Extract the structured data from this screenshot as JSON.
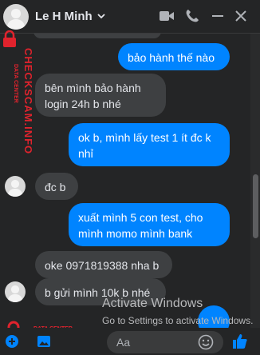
{
  "header": {
    "name": "Le H Minh",
    "icons": [
      "chevron-down-icon",
      "video-icon",
      "phone-icon",
      "minimize-icon",
      "close-icon"
    ]
  },
  "messages": [
    {
      "id": "m0",
      "from": "contact",
      "text": ""
    },
    {
      "id": "m1",
      "from": "me",
      "text": "bảo hành thế nào"
    },
    {
      "id": "m2",
      "from": "contact",
      "text": "bên mình bảo hành login 24h b nhé"
    },
    {
      "id": "m3",
      "from": "me",
      "text": "ok b, mình lấy test 1 ít đc k nhỉ"
    },
    {
      "id": "m4",
      "from": "contact",
      "text": "đc b"
    },
    {
      "id": "m5",
      "from": "me",
      "text": "xuất mình 5 con test, cho mình momo mình bank"
    },
    {
      "id": "m6",
      "from": "contact",
      "text": "oke 0971819388 nha b"
    },
    {
      "id": "m7",
      "from": "contact",
      "text": "b gửi mình 10k b nhé"
    }
  ],
  "watermark": {
    "small": "DATA CENTER",
    "big": "CHECKSCAM.INFO"
  },
  "activation": {
    "title": "Activate Windows",
    "subtitle": "Go to Settings to activate Windows."
  },
  "composer": {
    "placeholder": "Aa"
  },
  "colors": {
    "outgoing": "#0084ff",
    "incoming": "#3e4042",
    "background": "#242526",
    "watermark": "#e0232d"
  }
}
